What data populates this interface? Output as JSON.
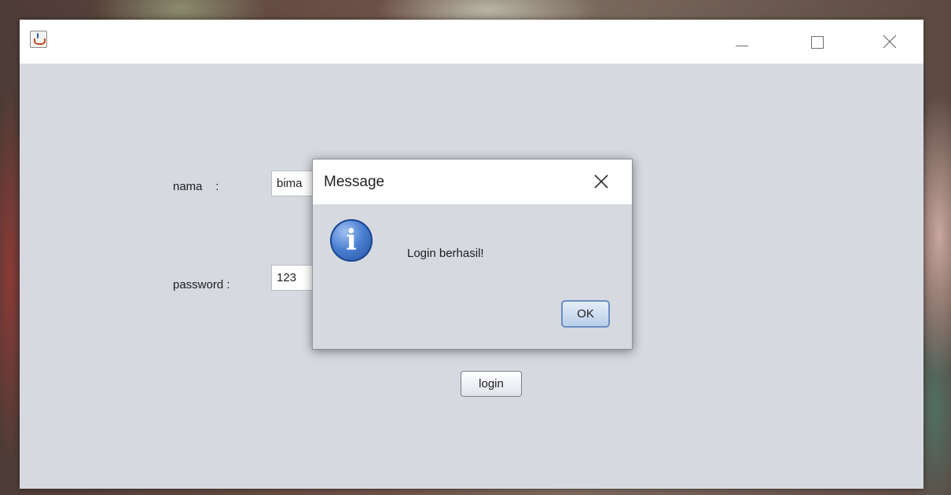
{
  "window": {
    "icon": "java-cup-icon",
    "controls": [
      "minimize-icon",
      "maximize-icon",
      "close-icon"
    ]
  },
  "form": {
    "nama_label": "nama    :",
    "nama_value": "bima",
    "password_label": "password :",
    "password_value": "123",
    "login_label": "login"
  },
  "dialog": {
    "title": "Message",
    "icon": "info-icon",
    "icon_glyph": "i",
    "message": "Login berhasil!",
    "ok_label": "OK"
  }
}
